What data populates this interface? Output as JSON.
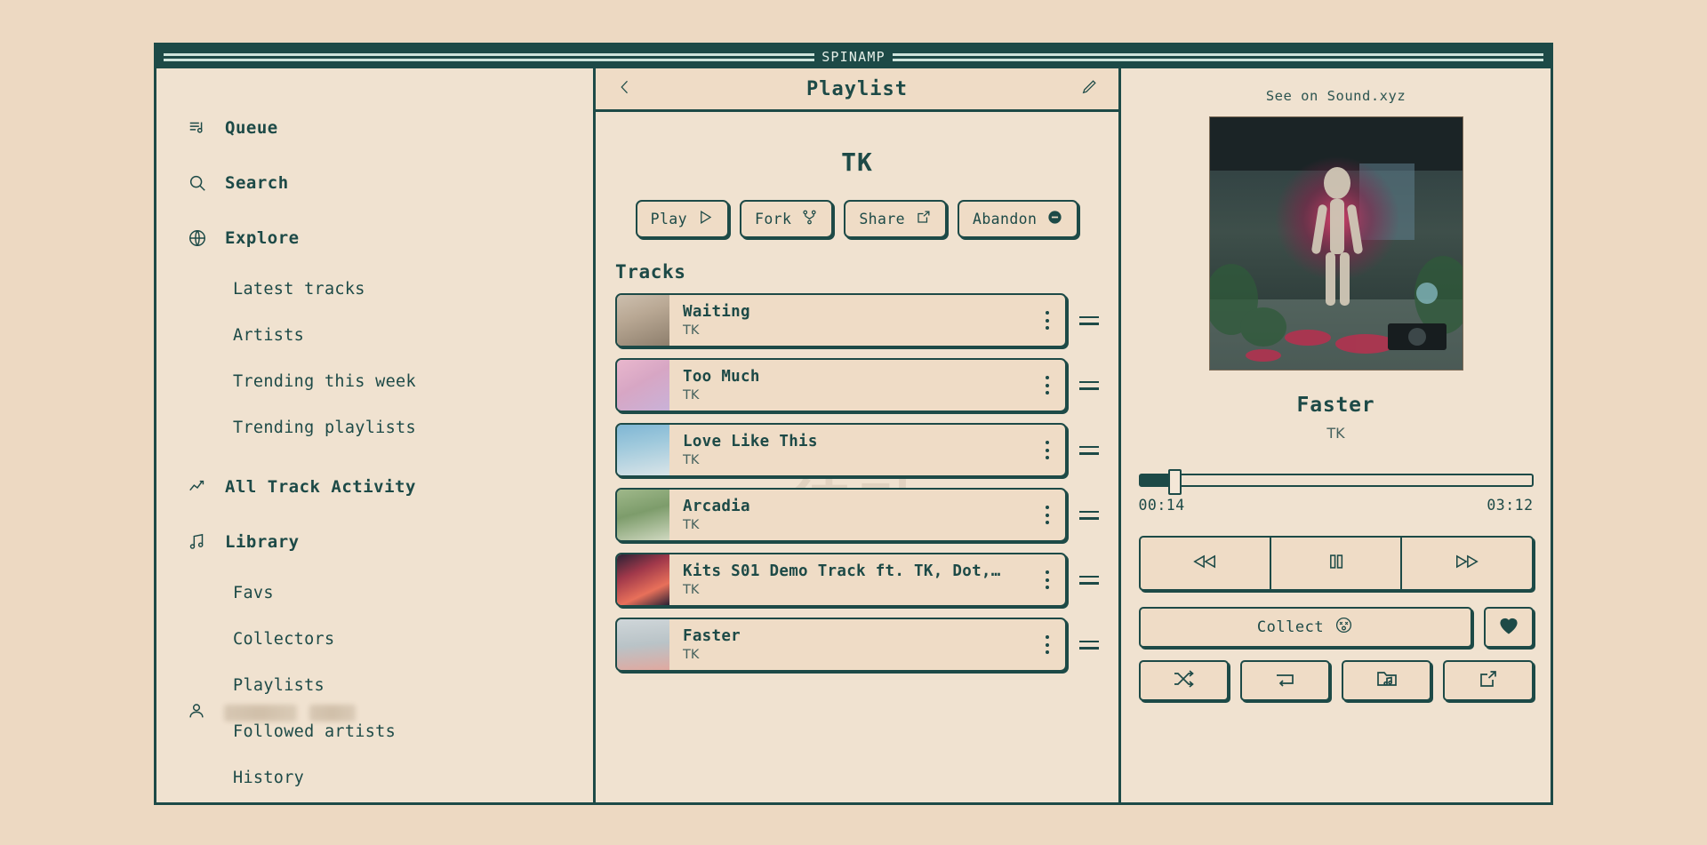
{
  "window": {
    "title": "SPINAMP"
  },
  "theme": {
    "page_bg": "#EDD9C2",
    "panel_bg": "#F0E2D0",
    "accent": "#1D4A47",
    "button_bg": "#EFDCC6"
  },
  "sidebar": {
    "items": [
      {
        "label": "Queue",
        "icon": "queue-list-music-icon",
        "type": "top"
      },
      {
        "label": "Search",
        "icon": "search-icon",
        "type": "top"
      },
      {
        "label": "Explore",
        "icon": "globe-icon",
        "type": "top"
      },
      {
        "label": "Latest tracks",
        "icon": "",
        "type": "sub"
      },
      {
        "label": "Artists",
        "icon": "",
        "type": "sub"
      },
      {
        "label": "Trending this week",
        "icon": "",
        "type": "sub"
      },
      {
        "label": "Trending playlists",
        "icon": "",
        "type": "sub"
      },
      {
        "label": "All Track Activity",
        "icon": "trend-up-icon",
        "type": "top"
      },
      {
        "label": "Library",
        "icon": "music-note-icon",
        "type": "top"
      },
      {
        "label": "Favs",
        "icon": "",
        "type": "sub"
      },
      {
        "label": "Collectors",
        "icon": "",
        "type": "sub"
      },
      {
        "label": "Playlists",
        "icon": "",
        "type": "sub"
      },
      {
        "label": "Followed artists",
        "icon": "",
        "type": "sub"
      },
      {
        "label": "History",
        "icon": "",
        "type": "sub"
      }
    ],
    "user": {
      "icon": "person-icon",
      "name_redacted": true
    }
  },
  "center": {
    "header": {
      "back_icon": "chevron-left-icon",
      "title": "Playlist",
      "edit_icon": "pencil-icon"
    },
    "playlist_name": "TK",
    "watermark": "律动",
    "actions": [
      {
        "label": "Play",
        "icon": "play-triangle-icon"
      },
      {
        "label": "Fork",
        "icon": "fork-icon"
      },
      {
        "label": "Share",
        "icon": "share-arrow-icon"
      },
      {
        "label": "Abandon",
        "icon": "minus-circle-filled-icon"
      }
    ],
    "tracks_label": "Tracks",
    "tracks": [
      {
        "title": "Waiting",
        "artist": "TK",
        "art": "desert"
      },
      {
        "title": "Too Much",
        "artist": "TK",
        "art": "blossom"
      },
      {
        "title": "Love Like This",
        "artist": "TK",
        "art": "mountain"
      },
      {
        "title": "Arcadia",
        "artist": "TK",
        "art": "forest"
      },
      {
        "title": "Kits S01 Demo Track ft. TK, Dot,…",
        "artist": "TK",
        "art": "neon"
      },
      {
        "title": "Faster",
        "artist": "TK",
        "art": "figure"
      }
    ],
    "row_menu_icon": "vertical-dots-icon",
    "row_drag_icon": "drag-handle-icon"
  },
  "player": {
    "see_on_link": "See on Sound.xyz",
    "artwork_alt": "skeleton-figure-artwork",
    "now_playing_title": "Faster",
    "now_playing_artist": "TK",
    "progress": {
      "current_time": "00:14",
      "total_time": "03:12",
      "percent": 7.5
    },
    "transport": [
      {
        "name": "previous",
        "icon": "rewind-icon"
      },
      {
        "name": "pause",
        "icon": "pause-icon"
      },
      {
        "name": "next",
        "icon": "fast-forward-icon"
      }
    ],
    "collect": {
      "label": "Collect",
      "icon": "dizzy-face-icon"
    },
    "favorite_icon": "heart-filled-icon",
    "utilities": [
      {
        "name": "shuffle",
        "icon": "shuffle-icon"
      },
      {
        "name": "repeat",
        "icon": "repeat-icon"
      },
      {
        "name": "add-to-playlist",
        "icon": "folder-music-icon"
      },
      {
        "name": "share",
        "icon": "share-arrow-icon"
      }
    ]
  }
}
